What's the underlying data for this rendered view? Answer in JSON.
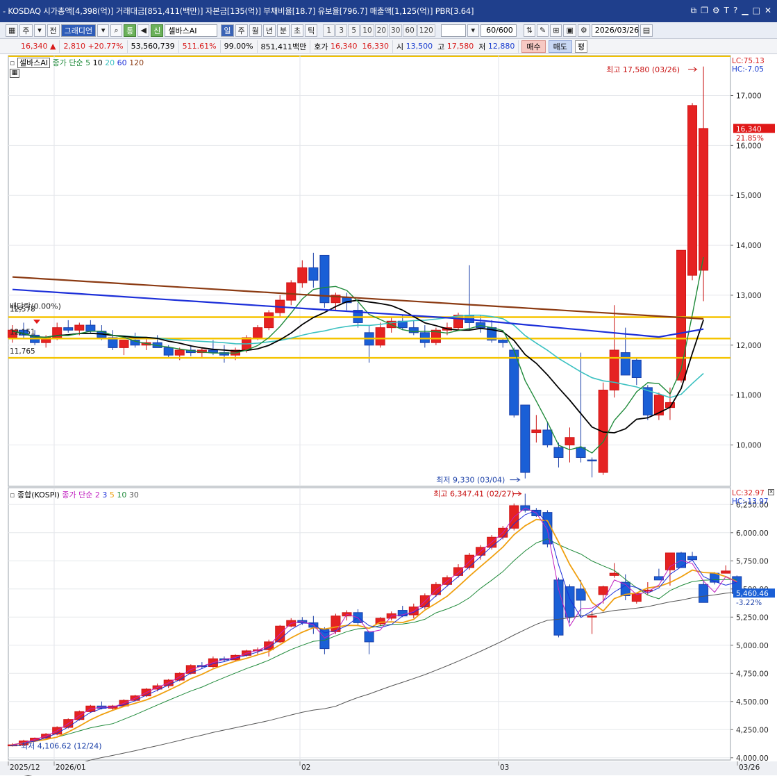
{
  "window": {
    "title": "- KOSDAQ 시가총액[4,398(억)] 거래대금[851,411(백만)] 자본금[135(억)] 부채비율[18.7] 유보율[796.7] 매출액[1,125(억)] PBR[3.64]"
  },
  "toolbar": {
    "period_week": "주",
    "prev_label": "전",
    "stock_code": "그래디언",
    "tong_label": "통",
    "credit_label": "신",
    "stock_name": "셀바스AI",
    "periods": [
      "일",
      "주",
      "월",
      "년",
      "분",
      "초",
      "틱"
    ],
    "active_period": "일",
    "intervals": [
      "1",
      "3",
      "5",
      "10",
      "20",
      "30",
      "60",
      "120"
    ],
    "count": "60/600",
    "date": "2026/03/26"
  },
  "quote": {
    "price": "16,340",
    "change_arrow": "▲",
    "change": "2,810",
    "change_pct": "+20.77%",
    "volume": "53,560,739",
    "volume_ratio": "511.61%",
    "pct99": "99.00%",
    "amount": "851,411백만",
    "hoga_label": "호가",
    "ask": "16,340",
    "bid": "16,330",
    "open_label": "시",
    "open": "13,500",
    "high_label": "고",
    "high": "17,580",
    "low_label": "저",
    "low": "12,880",
    "buy_label": "매수",
    "sell_label": "매도",
    "flat_label": "평"
  },
  "top_panel": {
    "name": "셀바스AI",
    "ma_label": "종가 단순",
    "ma_periods": [
      "5",
      "10",
      "20",
      "60",
      "120"
    ],
    "ma_colors": [
      "#1f8a3a",
      "#000000",
      "#3bc1c1",
      "#1c2fd9",
      "#8b3a12"
    ],
    "lc": "LC:75.13",
    "hc": "HC:-7.05",
    "high_marker": "최고 17,580 (03/26)",
    "low_marker": "최저 9,330 (03/04)",
    "dividend": "배당락(0.00%)",
    "hline_labels": [
      "12,578",
      "12,151",
      "11,765"
    ],
    "price_tag": "16,340",
    "price_pct": "21.85%"
  },
  "bottom_panel": {
    "name": "종합(KOSPI)",
    "ma_label": "종가 단순",
    "ma_periods": [
      "2",
      "3",
      "5",
      "10",
      "30"
    ],
    "ma_colors": [
      "#c020c0",
      "#1c2fd9",
      "#f0a010",
      "#1f8a3a",
      "#555555"
    ],
    "lc": "LC:32.97",
    "hc": "HC:-13.97",
    "high_marker": "최고 6,347.41 (02/27)",
    "low_marker": "최저 4,106.62 (12/24)",
    "price_tag": "5,460.46",
    "price_pct": "-3.22%"
  },
  "x_labels": [
    "2025/12",
    "2026/01",
    "02",
    "03",
    "03/26"
  ],
  "chart_data": [
    {
      "type": "candlestick",
      "title": "셀바스AI",
      "yticks": [
        "10,000",
        "11,000",
        "12,000",
        "13,000",
        "14,000",
        "15,000",
        "16,000",
        "17,000"
      ],
      "ylim": [
        9200,
        17800
      ],
      "horizontal_lines": [
        12578,
        12151,
        11765
      ],
      "candles": [
        [
          12150,
          12400,
          12050,
          12300
        ],
        [
          12300,
          12450,
          12150,
          12200
        ],
        [
          12200,
          12300,
          12000,
          12050
        ],
        [
          12050,
          12200,
          11950,
          12150
        ],
        [
          12150,
          12450,
          12100,
          12350
        ],
        [
          12350,
          12500,
          12250,
          12300
        ],
        [
          12300,
          12450,
          12200,
          12400
        ],
        [
          12400,
          12500,
          12250,
          12280
        ],
        [
          12280,
          12400,
          12100,
          12150
        ],
        [
          12150,
          12300,
          11900,
          11950
        ],
        [
          11950,
          12100,
          11800,
          12100
        ],
        [
          12100,
          12250,
          11950,
          12000
        ],
        [
          12000,
          12150,
          11900,
          12050
        ],
        [
          12050,
          12200,
          11950,
          11950
        ],
        [
          11950,
          12000,
          11750,
          11800
        ],
        [
          11800,
          11950,
          11700,
          11900
        ],
        [
          11900,
          12000,
          11780,
          11850
        ],
        [
          11850,
          11950,
          11750,
          11900
        ],
        [
          11900,
          12100,
          11800,
          11850
        ],
        [
          11850,
          12000,
          11650,
          11800
        ],
        [
          11800,
          11950,
          11700,
          11900
        ],
        [
          11900,
          12200,
          11850,
          12150
        ],
        [
          12150,
          12400,
          12100,
          12350
        ],
        [
          12350,
          12700,
          12300,
          12650
        ],
        [
          12650,
          13000,
          12550,
          12900
        ],
        [
          12900,
          13300,
          12800,
          13250
        ],
        [
          13250,
          13700,
          13150,
          13550
        ],
        [
          13550,
          13850,
          13150,
          13300
        ],
        [
          13800,
          13800,
          12750,
          12850
        ],
        [
          12850,
          13050,
          12700,
          13000
        ],
        [
          12950,
          13050,
          12700,
          12850
        ],
        [
          12700,
          12850,
          12350,
          12450
        ],
        [
          12250,
          12400,
          11650,
          12000
        ],
        [
          12000,
          12450,
          11950,
          12350
        ],
        [
          12350,
          12550,
          12250,
          12480
        ],
        [
          12480,
          12600,
          12300,
          12350
        ],
        [
          12350,
          12500,
          12200,
          12250
        ],
        [
          12250,
          12400,
          11950,
          12050
        ],
        [
          12050,
          12350,
          12000,
          12300
        ],
        [
          12300,
          12450,
          12200,
          12350
        ],
        [
          12350,
          12650,
          12300,
          12600
        ],
        [
          12600,
          13600,
          12300,
          12450
        ],
        [
          12450,
          12600,
          12250,
          12350
        ],
        [
          12350,
          12500,
          12050,
          12100
        ],
        [
          12100,
          12150,
          11950,
          12050
        ],
        [
          11900,
          11950,
          10550,
          10600
        ],
        [
          10800,
          10800,
          9330,
          9450
        ],
        [
          10250,
          10600,
          10050,
          10300
        ],
        [
          10300,
          10450,
          9950,
          10000
        ],
        [
          9950,
          10050,
          9550,
          9750
        ],
        [
          10000,
          10350,
          9650,
          10150
        ],
        [
          9950,
          11850,
          9650,
          9750
        ],
        [
          9700,
          9750,
          9350,
          9680
        ],
        [
          9450,
          11250,
          9400,
          11100
        ],
        [
          11100,
          12800,
          10950,
          11900
        ],
        [
          11850,
          12350,
          11550,
          11400
        ],
        [
          11700,
          11750,
          11200,
          11350
        ],
        [
          11150,
          11200,
          10500,
          10600
        ],
        [
          10600,
          11050,
          10500,
          11000
        ],
        [
          10750,
          11150,
          10500,
          10850
        ],
        [
          11300,
          13900,
          11250,
          13900
        ],
        [
          13400,
          16850,
          13300,
          16800
        ],
        [
          13500,
          17580,
          12880,
          16340
        ]
      ]
    },
    {
      "type": "candlestick",
      "title": "종합(KOSPI)",
      "yticks": [
        "4,000.00",
        "4,250.00",
        "4,500.00",
        "4,750.00",
        "5,000.00",
        "5,250.00",
        "5,500.00",
        "5,750.00",
        "6,000.00",
        "6,250.00"
      ],
      "ylim": [
        3980,
        6400
      ],
      "candles": [
        [
          4110,
          4130,
          4100,
          4115
        ],
        [
          4115,
          4160,
          4105,
          4150
        ],
        [
          4150,
          4180,
          4140,
          4175
        ],
        [
          4175,
          4220,
          4165,
          4210
        ],
        [
          4210,
          4280,
          4200,
          4270
        ],
        [
          4270,
          4350,
          4260,
          4340
        ],
        [
          4340,
          4420,
          4330,
          4410
        ],
        [
          4410,
          4470,
          4400,
          4460
        ],
        [
          4460,
          4500,
          4430,
          4440
        ],
        [
          4440,
          4470,
          4420,
          4460
        ],
        [
          4460,
          4520,
          4450,
          4510
        ],
        [
          4510,
          4560,
          4500,
          4550
        ],
        [
          4550,
          4620,
          4540,
          4610
        ],
        [
          4610,
          4660,
          4590,
          4640
        ],
        [
          4640,
          4700,
          4620,
          4690
        ],
        [
          4690,
          4760,
          4680,
          4750
        ],
        [
          4750,
          4830,
          4740,
          4820
        ],
        [
          4820,
          4850,
          4790,
          4810
        ],
        [
          4810,
          4900,
          4800,
          4880
        ],
        [
          4880,
          4900,
          4850,
          4870
        ],
        [
          4870,
          4920,
          4860,
          4910
        ],
        [
          4910,
          4960,
          4900,
          4950
        ],
        [
          4950,
          4980,
          4920,
          4960
        ],
        [
          4960,
          5050,
          4900,
          5030
        ],
        [
          5030,
          5180,
          5020,
          5170
        ],
        [
          5170,
          5240,
          5160,
          5220
        ],
        [
          5220,
          5250,
          5180,
          5200
        ],
        [
          5200,
          5260,
          5100,
          5160
        ],
        [
          5140,
          5160,
          4920,
          4970
        ],
        [
          5120,
          5280,
          5100,
          5260
        ],
        [
          5260,
          5310,
          5220,
          5290
        ],
        [
          5290,
          5320,
          5170,
          5200
        ],
        [
          5120,
          5120,
          4920,
          5030
        ],
        [
          5190,
          5250,
          5170,
          5240
        ],
        [
          5240,
          5300,
          5220,
          5280
        ],
        [
          5310,
          5350,
          5250,
          5260
        ],
        [
          5270,
          5370,
          5240,
          5340
        ],
        [
          5340,
          5460,
          5320,
          5440
        ],
        [
          5450,
          5560,
          5430,
          5540
        ],
        [
          5540,
          5620,
          5520,
          5600
        ],
        [
          5620,
          5720,
          5600,
          5690
        ],
        [
          5690,
          5820,
          5670,
          5800
        ],
        [
          5800,
          5890,
          5760,
          5870
        ],
        [
          5870,
          5980,
          5850,
          5960
        ],
        [
          5960,
          6060,
          5940,
          6040
        ],
        [
          6040,
          6260,
          6020,
          6240
        ],
        [
          6240,
          6347,
          6180,
          6200
        ],
        [
          6200,
          6220,
          6140,
          6150
        ],
        [
          6180,
          6200,
          5870,
          5900
        ],
        [
          5580,
          5600,
          5070,
          5090
        ],
        [
          5520,
          5540,
          5200,
          5250
        ],
        [
          5500,
          5580,
          5250,
          5400
        ],
        [
          5250,
          5300,
          5100,
          5260
        ],
        [
          5450,
          5530,
          5370,
          5520
        ],
        [
          5620,
          5730,
          5600,
          5640
        ],
        [
          5560,
          5630,
          5400,
          5440
        ],
        [
          5390,
          5460,
          5370,
          5460
        ],
        [
          5480,
          5560,
          5450,
          5490
        ],
        [
          5610,
          5680,
          5590,
          5580
        ],
        [
          5670,
          5700,
          5530,
          5820
        ],
        [
          5820,
          5830,
          5810,
          5690
        ],
        [
          5790,
          5830,
          5760,
          5760
        ],
        [
          5540,
          5570,
          5380,
          5380
        ],
        [
          5640,
          5650,
          5540,
          5560
        ],
        [
          5640,
          5710,
          5640,
          5660
        ],
        [
          5610,
          5620,
          5440,
          5460
        ]
      ]
    }
  ]
}
